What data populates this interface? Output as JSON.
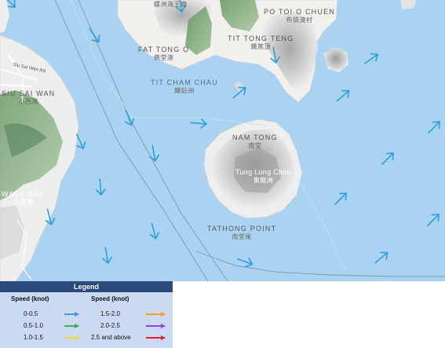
{
  "map": {
    "labels": {
      "lo_tin_ancient": {
        "en": "",
        "zh": "螺洲海王廟"
      },
      "po_toi_o_chuen": {
        "en": "PO TOI O CHUEN",
        "zh": "布袋澳村"
      },
      "fat_tong_o": {
        "en": "FAT TONG O",
        "zh": "佛堂澳"
      },
      "tit_tong_teng": {
        "en": "TIT TONG TENG",
        "zh": "鐵篤頂"
      },
      "tit_cham_chau": {
        "en": "TIT CHAM CHAU",
        "zh": "鐵鉆洲"
      },
      "siu_sai_wan": {
        "en": "SIU SAI WAN",
        "zh": "小西灣"
      },
      "sui_sai_wan_road": {
        "en": "Siu Sai Wan Rd",
        "zh": ""
      },
      "nam_tong": {
        "en": "NAM TONG",
        "zh": "南堂"
      },
      "tung_lung_chau": {
        "en": "Tung Lung Chau",
        "zh": "東龍洲"
      },
      "wave_bay": {
        "en": "WAVE BAY",
        "zh": "大浪灣"
      },
      "tathong_point": {
        "en": "TATHONG POINT",
        "zh": "南堂尾"
      }
    },
    "current_arrows": [
      {
        "speed_class": "0-0.5",
        "direction_deg": 40
      },
      {
        "speed_class": "0-0.5",
        "direction_deg": 0
      },
      {
        "speed_class": "0-0.5",
        "direction_deg": -20
      },
      {
        "speed_class": "0-0.5",
        "direction_deg": -30
      },
      {
        "speed_class": "0-0.5",
        "direction_deg": 90
      }
    ]
  },
  "legend": {
    "title": "Legend",
    "header_left": "Speed (knot)",
    "header_right": "Speed (knot)",
    "rows": [
      {
        "left_range": "0-0.5",
        "left_color": "#3aa0d8",
        "right_range": "1.5-2.0",
        "right_color": "#f0a030"
      },
      {
        "left_range": "0.5-1.0",
        "left_color": "#36b04a",
        "right_range": "2.0-2.5",
        "right_color": "#9a40d8"
      },
      {
        "left_range": "1.0-1.5",
        "left_color": "#e8e030",
        "right_range": "2.5 and above",
        "right_color": "#e02030"
      }
    ]
  },
  "colors": {
    "water": "#a9d3f0",
    "land": "#f2f1ee",
    "arrow_0_0_5": "#2b9fd8"
  }
}
